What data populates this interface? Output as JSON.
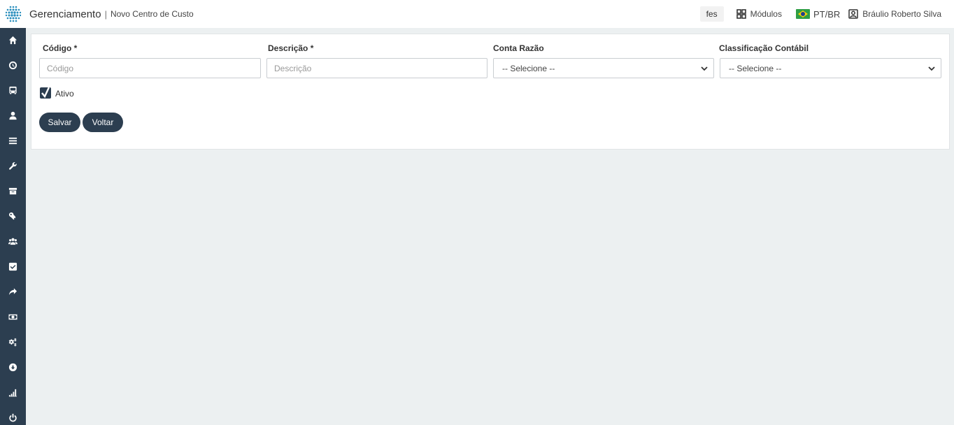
{
  "header": {
    "app_title": "Gerenciamento",
    "separator": "|",
    "page_title": "Novo Centro de Custo",
    "company_chip": "fes",
    "modules_label": "Módulos",
    "language_label": "PT/BR",
    "user_name": "Bráulio Roberto Silva"
  },
  "sidebar": {
    "items": [
      {
        "icon": "home-icon"
      },
      {
        "icon": "clock-icon"
      },
      {
        "icon": "bus-icon"
      },
      {
        "icon": "user-icon"
      },
      {
        "icon": "list-icon"
      },
      {
        "icon": "wrench-icon"
      },
      {
        "icon": "archive-icon"
      },
      {
        "icon": "key-icon"
      },
      {
        "icon": "users-icon"
      },
      {
        "icon": "checkbox-icon"
      },
      {
        "icon": "share-icon"
      },
      {
        "icon": "money-icon"
      },
      {
        "icon": "cogs-icon"
      },
      {
        "icon": "download-icon"
      },
      {
        "icon": "signal-icon"
      },
      {
        "icon": "power-icon"
      }
    ]
  },
  "form": {
    "codigo": {
      "label": "Código *",
      "placeholder": "Código",
      "value": ""
    },
    "descricao": {
      "label": "Descrição *",
      "placeholder": "Descrição",
      "value": ""
    },
    "conta_razao": {
      "label": "Conta Razão",
      "selected": "-- Selecione --"
    },
    "classificacao": {
      "label": "Classificação Contábil",
      "selected": "-- Selecione --"
    },
    "ativo": {
      "label": "Ativo",
      "checked": true
    },
    "save_label": "Salvar",
    "back_label": "Voltar"
  },
  "colors": {
    "primary": "#2c3e50",
    "background": "#ecf0f1",
    "logo": "#2a8fbd"
  }
}
